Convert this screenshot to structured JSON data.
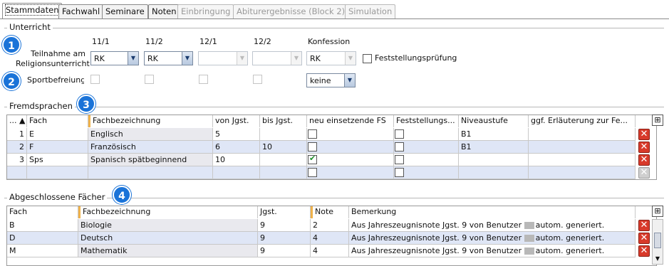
{
  "tabs": [
    {
      "label": "Stammdaten",
      "state": "active"
    },
    {
      "label": "Fachwahl",
      "state": "normal"
    },
    {
      "label": "Seminare",
      "state": "normal"
    },
    {
      "label": "Noten",
      "state": "normal"
    },
    {
      "label": "Einbringung",
      "state": "disabled"
    },
    {
      "label": "Abiturergebnisse (Block 2)",
      "state": "disabled"
    },
    {
      "label": "Simulation",
      "state": "disabled"
    }
  ],
  "unterricht": {
    "title": "Unterricht",
    "badge1": "1",
    "badge2": "2",
    "columns": [
      "11/1",
      "11/2",
      "12/1",
      "12/2",
      "Konfession"
    ],
    "religion_label": "Teilnahme am Religionsunterricht",
    "religion_values": [
      "RK",
      "RK",
      "",
      ""
    ],
    "konfession": "RK",
    "feststellung_label": "Feststellungsprüfung",
    "sport_label": "Sportbefreiung",
    "sport_select": "keine"
  },
  "fremdsprachen": {
    "title": "Fremdsprachen",
    "badge": "3",
    "headers": [
      "...",
      "Fach",
      "Fachbezeichnung",
      "von Jgst.",
      "bis Jgst.",
      "neu einsetzende FS",
      "Feststellungs...",
      "Niveaustufe",
      "ggf. Erläuterung zur Fe..."
    ],
    "rows": [
      {
        "nr": "1",
        "fach": "E",
        "bez": "Englisch",
        "von": "5",
        "bis": "",
        "neu": false,
        "fest": false,
        "niveau": "B1",
        "erl": ""
      },
      {
        "nr": "2",
        "fach": "F",
        "bez": "Französisch",
        "von": "6",
        "bis": "10",
        "neu": false,
        "fest": false,
        "niveau": "B1",
        "erl": ""
      },
      {
        "nr": "3",
        "fach": "Sps",
        "bez": "Spanisch spätbeginnend",
        "von": "10",
        "bis": "",
        "neu": true,
        "fest": false,
        "niveau": "",
        "erl": ""
      },
      {
        "nr": "",
        "fach": "",
        "bez": "",
        "von": "",
        "bis": "",
        "neu": false,
        "fest": false,
        "niveau": "",
        "erl": ""
      }
    ]
  },
  "abgeschlossen": {
    "title": "Abgeschlossene Fächer",
    "badge": "4",
    "headers": [
      "Fach",
      "Fachbezeichnung",
      "Jgst.",
      "Note",
      "Bemerkung"
    ],
    "rows": [
      {
        "fach": "B",
        "bez": "Biologie",
        "jgst": "9",
        "note": "2",
        "bem1": "Aus Jahreszeugnisnote Jgst.  9 von Benutzer",
        "bem2": "autom. generiert."
      },
      {
        "fach": "D",
        "bez": "Deutsch",
        "jgst": "9",
        "note": "4",
        "bem1": "Aus Jahreszeugnisnote Jgst.  9 von Benutzer",
        "bem2": "autom. generiert."
      },
      {
        "fach": "M",
        "bez": "Mathematik",
        "jgst": "9",
        "note": "4",
        "bem1": "Aus Jahreszeugnisnote Jgst.  9 von Benutzer",
        "bem2": "autom. generiert."
      }
    ]
  },
  "colors": {
    "accent": "#1a73d8",
    "selected_row": "#dfe6f6",
    "delete": "#d83a2a",
    "check": "#1f8f2a"
  }
}
